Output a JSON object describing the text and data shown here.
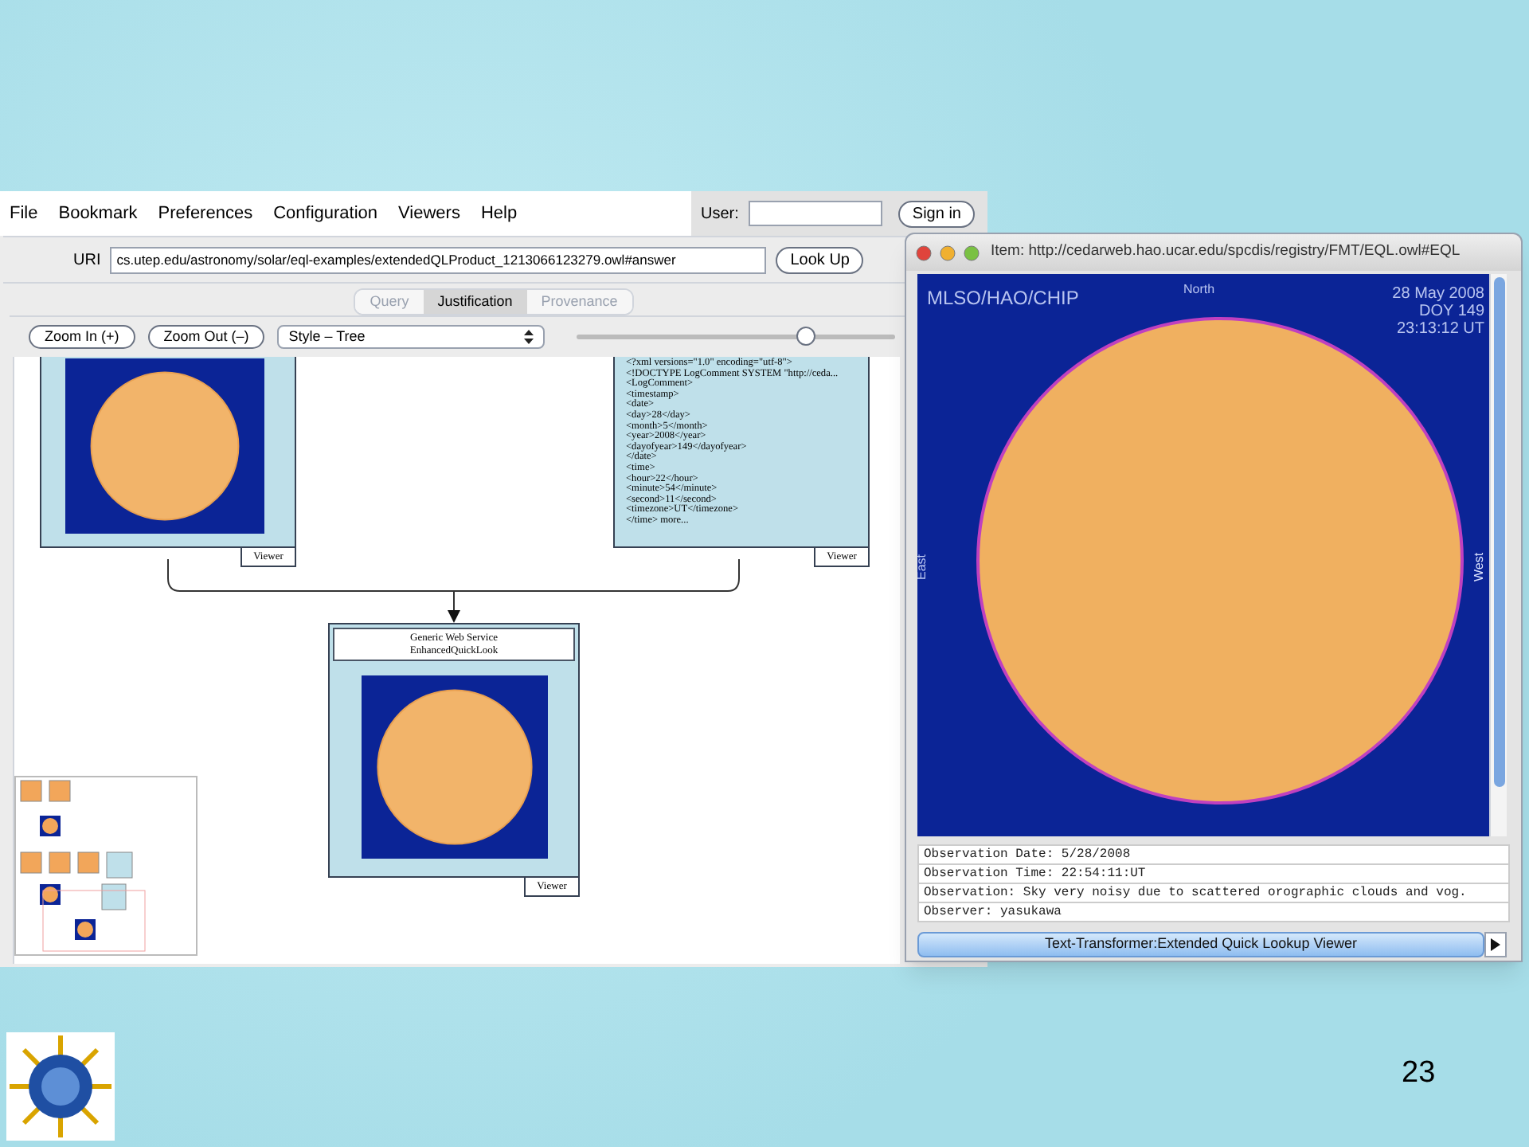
{
  "menu": [
    "File",
    "Bookmark",
    "Preferences",
    "Configuration",
    "Viewers",
    "Help"
  ],
  "user_field": {
    "label": "User:"
  },
  "sign_in": "Sign in",
  "uri": {
    "label": "URI",
    "value": "cs.utep.edu/astronomy/solar/eql-examples/extendedQLProduct_1213066123279.owl#answer"
  },
  "look_up": "Look Up",
  "tabs": [
    {
      "label": "Query",
      "selected": false
    },
    {
      "label": "Justification",
      "selected": true
    },
    {
      "label": "Provenance",
      "selected": false
    }
  ],
  "toolbar": {
    "zoom_in": "Zoom In (+)",
    "zoom_out": "Zoom Out (–)",
    "style": "Style – Tree",
    "zoom_slider": {
      "level": 0.72
    }
  },
  "graph": {
    "nodes": [
      {
        "kind": "image",
        "footer": "Viewer"
      },
      {
        "kind": "xml",
        "footer": "Viewer",
        "lines": [
          "<?xml versions=\"1.0\" encoding=\"utf-8\">",
          "<!DOCTYPE LogComment SYSTEM \"http://ceda...",
          "<LogComment>",
          "<timestamp>",
          "<date>",
          "<day>28</day>",
          "<month>5</month>",
          "<year>2008</year>",
          "<dayofyear>149</dayofyear>",
          "</date>",
          "<time>",
          "<hour>22</hour>",
          "<minute>54</minute>",
          "<second>11</second>",
          "<timezone>UT</timezone>",
          "</time> more..."
        ]
      },
      {
        "kind": "service",
        "footer": "Viewer",
        "header": [
          "Generic Web Service",
          "EnhancedQuickLook"
        ]
      }
    ]
  },
  "viewer": {
    "title": "Item: http://cedarweb.hao.ucar.edu/spcdis/registry/FMT/EQL.owl#EQL",
    "image_labels": {
      "instrument": "MLSO/HAO/CHIP",
      "north": "North",
      "date": "28 May 2008",
      "doy": "DOY 149",
      "time": "23:13:12 UT",
      "east": "East",
      "west": "West"
    },
    "fields": [
      "Observation Date: 5/28/2008",
      "Observation Time: 22:54:11:UT",
      "Observation: Sky very noisy due to scattered orographic clouds and vog.",
      "Observer: yasukawa"
    ],
    "transformer": "Text-Transformer:Extended Quick Lookup Viewer"
  },
  "slide_number": "23"
}
